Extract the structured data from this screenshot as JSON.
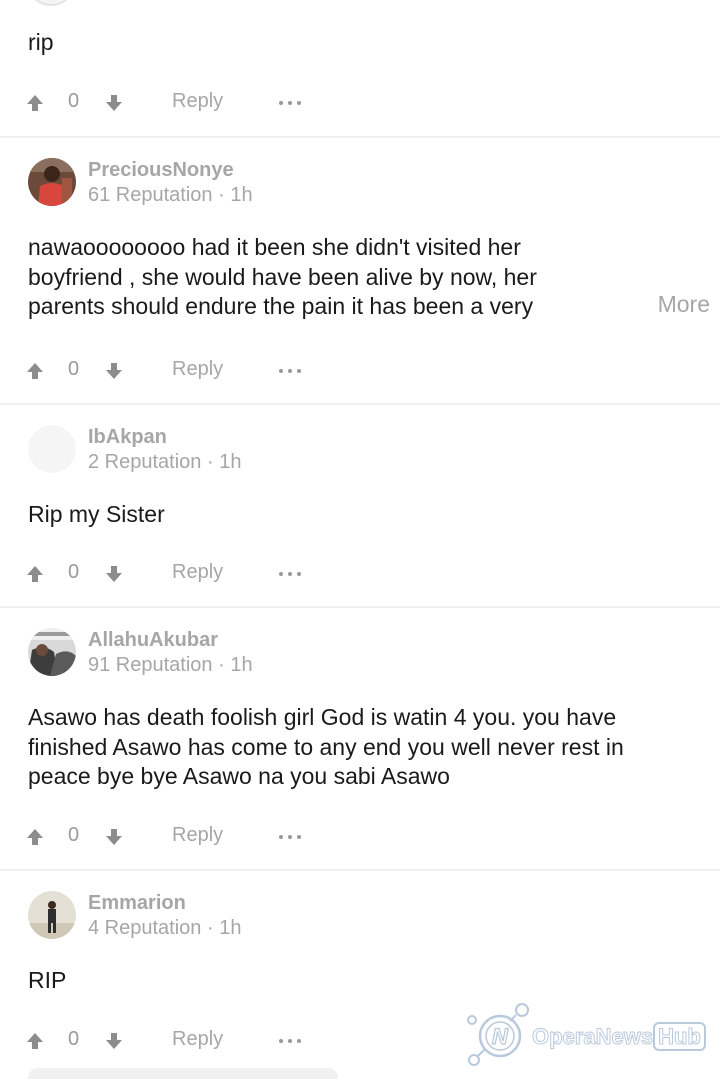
{
  "comments": [
    {
      "username": "",
      "meta": "",
      "text": "rip",
      "votes": "0",
      "reply_label": "Reply"
    },
    {
      "username": "PreciousNonye",
      "meta": "61 Reputation · 1h",
      "text": "nawaoooooooo had it been she didn't visited her boyfriend , she would have been alive by now, her parents should endure the pain it has been a very",
      "more_label": "More",
      "votes": "0",
      "reply_label": "Reply"
    },
    {
      "username": "IbAkpan",
      "meta": "2 Reputation · 1h",
      "text": "Rip my Sister",
      "votes": "0",
      "reply_label": "Reply"
    },
    {
      "username": "AllahuAkubar",
      "meta": "91 Reputation · 1h",
      "text": "Asawo has death foolish girl God is watin 4 you. you have finished Asawo has come to any end you well never rest in peace bye bye Asawo na you sabi Asawo",
      "votes": "0",
      "reply_label": "Reply"
    },
    {
      "username": "Emmarion",
      "meta": "4 Reputation · 1h",
      "text": "RIP",
      "votes": "0",
      "reply_label": "Reply"
    }
  ],
  "watermark": {
    "brand": "OperaNews",
    "hub": "Hub"
  },
  "icons": {
    "upvote": "arrow-up-icon",
    "downvote": "arrow-down-icon",
    "more": "ellipsis-icon"
  },
  "colors": {
    "icon_gray": "#8c8c8c",
    "muted_text": "#a6a6a6",
    "divider": "#efefef",
    "watermark_outline": "#b9c9dc"
  }
}
